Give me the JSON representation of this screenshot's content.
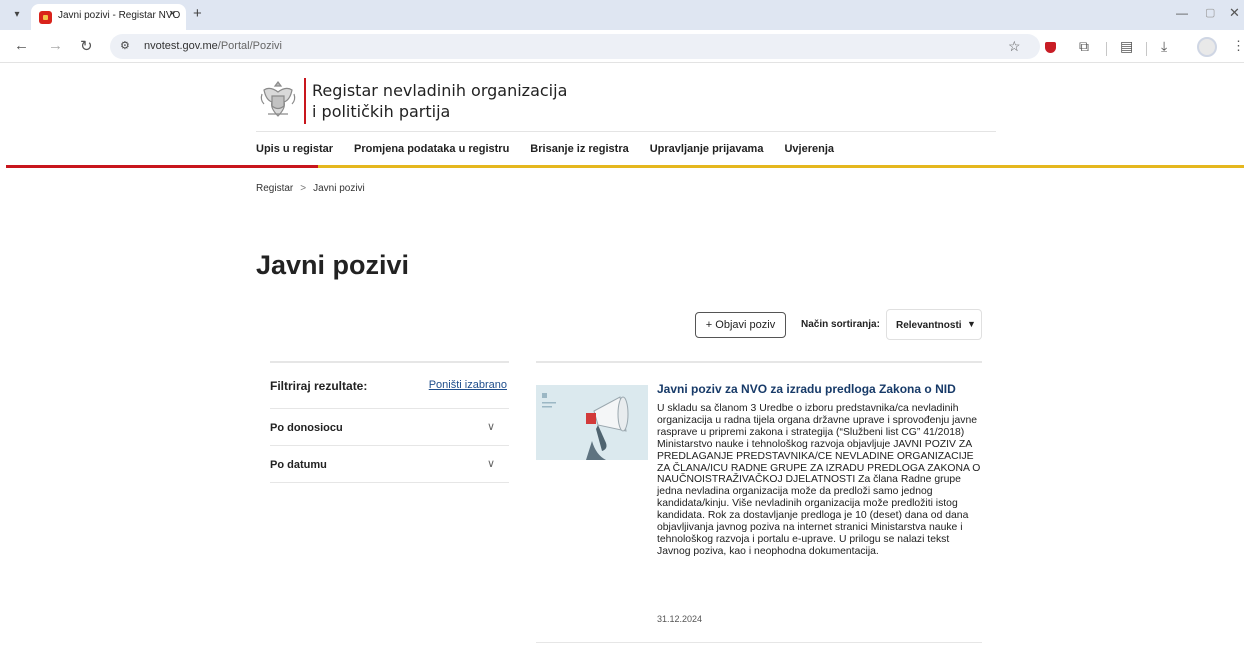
{
  "browser": {
    "tab_title": "Javni pozivi - Registar NVO",
    "tab_close": "×",
    "new_tab": "+",
    "url_host": "nvotest.gov.me",
    "url_path": "/Portal/Pozivi"
  },
  "site": {
    "title_line1": "Registar nevladinih organizacija",
    "title_line2": "i političkih partija",
    "nav": [
      "Upis u registar",
      "Promjena podataka u registru",
      "Brisanje iz registra",
      "Upravljanje prijavama",
      "Uvjerenja"
    ],
    "accent_red": "#c8161d",
    "accent_gold": "#e5b71e"
  },
  "breadcrumb": {
    "root": "Registar",
    "separator": ">",
    "current": "Javni pozivi"
  },
  "page": {
    "title": "Javni pozivi",
    "publish_button": "+ Objavi poziv",
    "sort_label": "Način sortiranja:",
    "sort_value": "Relevantnosti",
    "sort_caret": "▼"
  },
  "filters": {
    "title": "Filtriraj rezultate:",
    "reset": "Poništi izabrano",
    "items": [
      {
        "label": "Po donosiocu",
        "chevron": "∨"
      },
      {
        "label": "Po datumu",
        "chevron": "∨"
      }
    ]
  },
  "results": [
    {
      "title": "Javni poziv za NVO za izradu predloga Zakona o NID",
      "body": "U skladu sa članom 3 Uredbe o izboru predstavnika/ca nevladinih organizacija u radna tijela organa državne uprave i sprovođenju javne rasprave u pripremi zakona i strategija (“Službeni list CG” 41/2018) Ministarstvo nauke i tehnološkog razvoja objavljuje JAVNI POZIV ZA PREDLAGANJE PREDSTAVNIKA/CE NEVLADINE ORGANIZACIJE ZA ČLANA/ICU RADNE GRUPE ZA IZRADU PREDLOGA ZAKONA O NAUČNOISTRAŽIVAČKOJ DJELATNOSTI Za člana Radne grupe jedna nevladina organizacija može da predloži samo jednog kandidata/kinju. Više nevladinih organizacija može predložiti istog kandidata. Rok za dostavljanje predloga je 10 (deset) dana od dana objavljivanja javnog poziva na internet stranici Ministarstva nauke i tehnološkog razvoja i portalu e-uprave. U prilogu se nalazi tekst Javnog poziva, kao i neophodna dokumentacija.",
      "date": "31.12.2024"
    }
  ]
}
